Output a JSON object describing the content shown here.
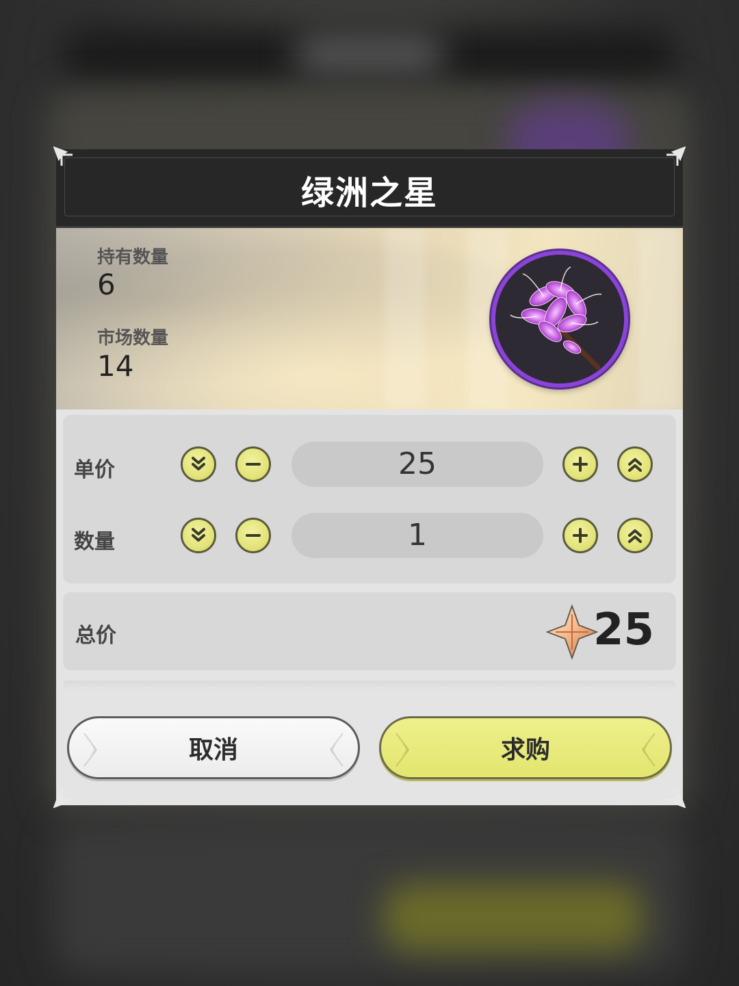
{
  "dialog": {
    "title": "绿洲之星",
    "owned_label": "持有数量",
    "owned_value": "6",
    "market_label": "市场数量",
    "market_value": "14",
    "item_icon": "purple-flower-icon"
  },
  "price_row": {
    "label": "单价",
    "value": "25"
  },
  "quantity_row": {
    "label": "数量",
    "value": "1"
  },
  "total": {
    "label": "总价",
    "value": "25",
    "currency_icon": "star-crystal-icon"
  },
  "buttons": {
    "cancel_label": "取消",
    "buy_label": "求购"
  },
  "colors": {
    "accent": "#e3e47a",
    "title_bar": "#272727",
    "item_ring": "#8a44d8"
  }
}
